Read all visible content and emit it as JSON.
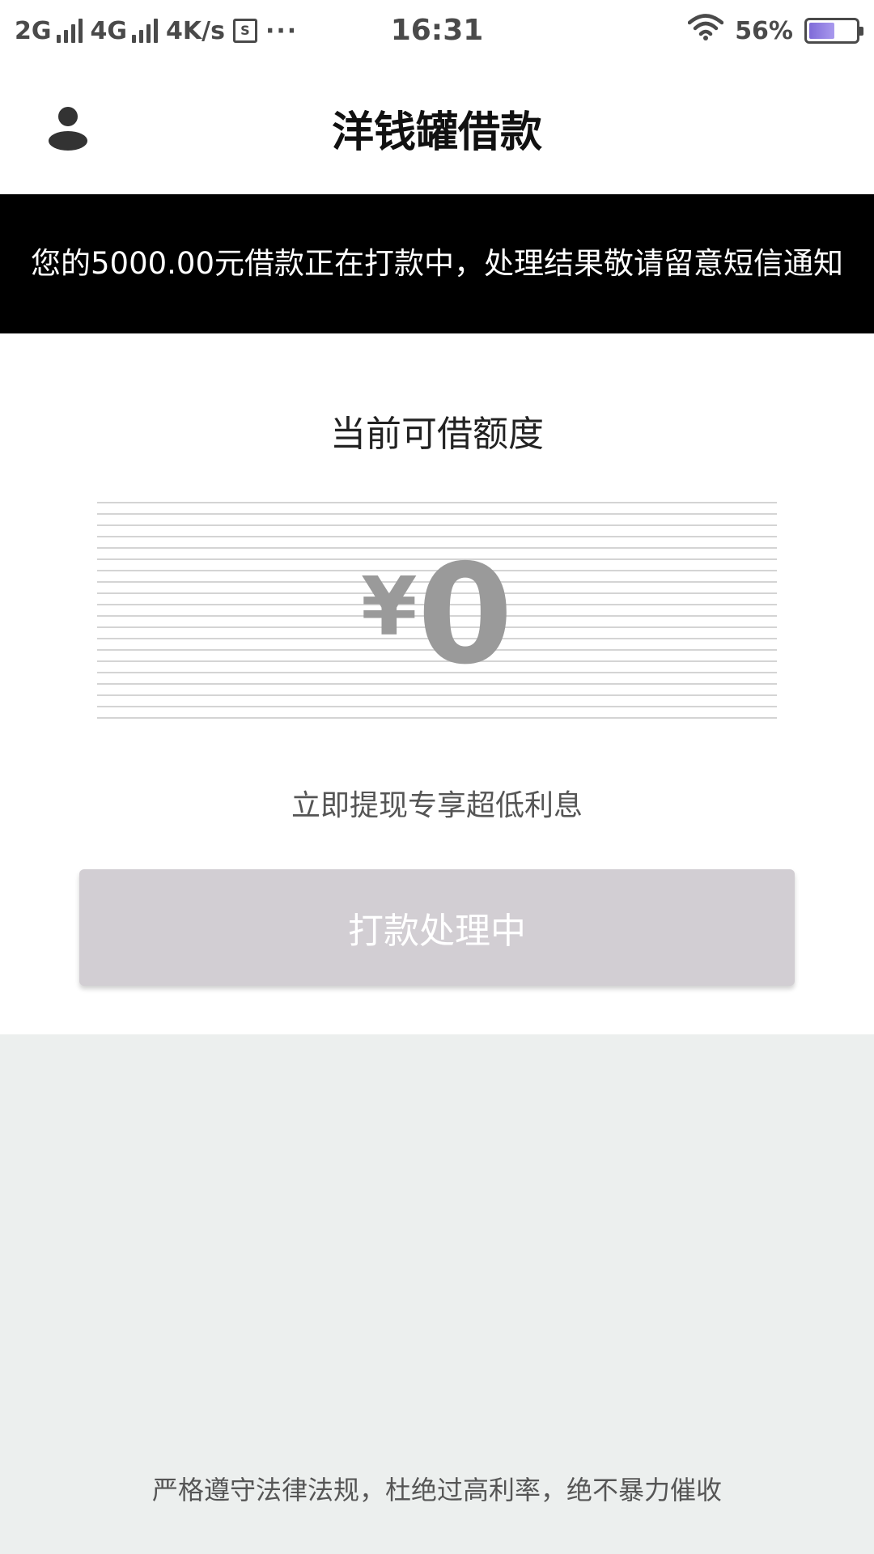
{
  "status_bar": {
    "network_1": "2G",
    "network_2": "4G",
    "speed": "4K/s",
    "sim_icon": "sim-card-icon",
    "more": "···",
    "time": "16:31",
    "wifi_icon": "wifi-icon",
    "battery_percent": "56%",
    "battery_level": 0.56
  },
  "header": {
    "title": "洋钱罐借款",
    "profile_icon": "user-profile-icon"
  },
  "notice": {
    "text": "您的5000.00元借款正在打款中，处理结果敬请留意短信通知"
  },
  "credit": {
    "label": "当前可借额度",
    "currency": "¥",
    "amount": "0",
    "promo": "立即提现专享超低利息",
    "button_label": "打款处理中"
  },
  "footer": {
    "text": "严格遵守法律法规，杜绝过高利率，绝不暴力催收"
  },
  "colors": {
    "notice_bg": "#000000",
    "button_bg": "#d2ced3",
    "amount": "#9a9a9a",
    "bottom_bg": "#ecefee",
    "battery_fill": "#8f7ee0"
  }
}
